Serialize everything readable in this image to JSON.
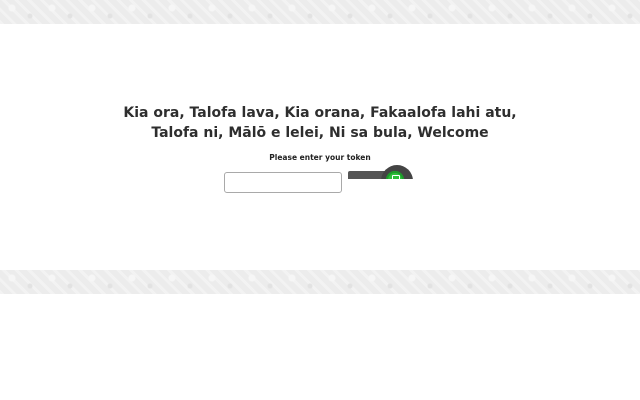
{
  "greeting": {
    "line1": "Kia ora, Talofa lava, Kia orana, Fakaalofa lahi atu,",
    "line2": "Talofa ni, Mālō e lelei, Ni sa bula, Welcome"
  },
  "token_form": {
    "label": "Please enter your token",
    "input_value": "",
    "submit_icon": "green-go-icon"
  },
  "colors": {
    "accent_green": "#2dbf3a",
    "band_gray": "#ececec",
    "text_dark": "#2e2e2e"
  }
}
